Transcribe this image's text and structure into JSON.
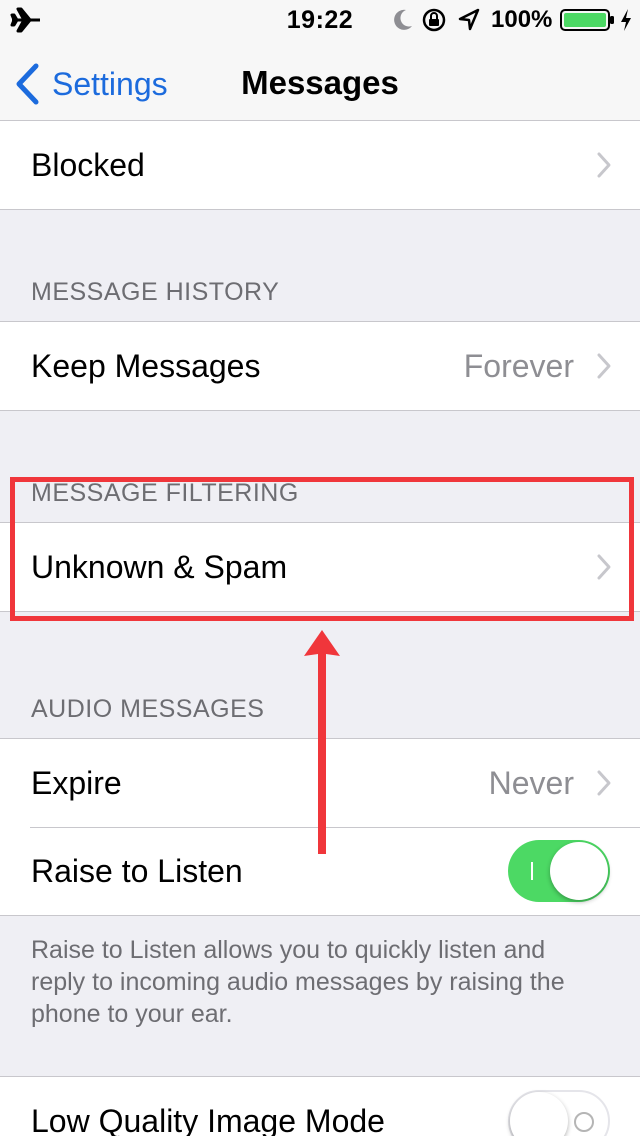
{
  "status_bar": {
    "time": "19:22",
    "battery_percent": "100%",
    "icons": [
      "airplane-icon",
      "moon-icon",
      "orientation-lock-icon",
      "location-icon",
      "battery-icon",
      "charging-icon"
    ],
    "battery_color": "#4cd964"
  },
  "nav": {
    "back_label": "Settings",
    "title": "Messages",
    "accent_color": "#1c6bdd"
  },
  "blocked": {
    "label": "Blocked"
  },
  "message_history": {
    "header": "MESSAGE HISTORY",
    "keep_messages": {
      "label": "Keep Messages",
      "value": "Forever"
    }
  },
  "message_filtering": {
    "header": "MESSAGE FILTERING",
    "unknown_spam": {
      "label": "Unknown & Spam"
    }
  },
  "audio_messages": {
    "header": "AUDIO MESSAGES",
    "expire": {
      "label": "Expire",
      "value": "Never"
    },
    "raise_to_listen": {
      "label": "Raise to Listen",
      "enabled": true
    },
    "footer": "Raise to Listen allows you to quickly listen and reply to incoming audio messages by raising the phone to your ear."
  },
  "low_quality": {
    "label": "Low Quality Image Mode",
    "enabled": false
  },
  "annotation": {
    "highlight_color": "#f0363b"
  }
}
